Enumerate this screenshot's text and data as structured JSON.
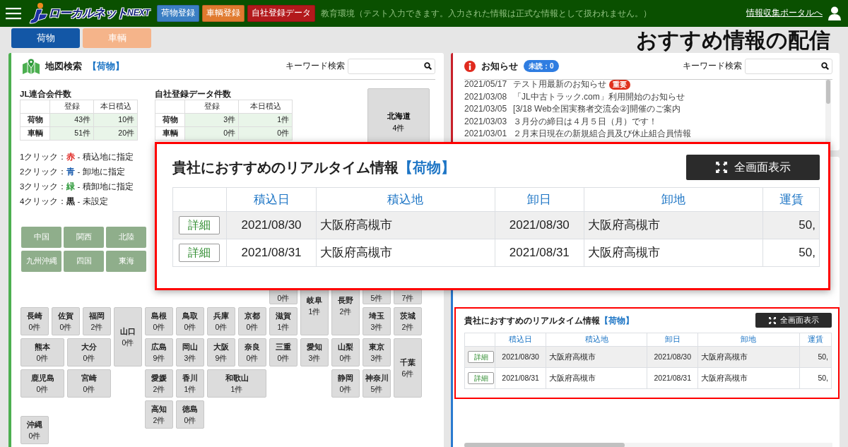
{
  "header": {
    "logo": {
      "name": "ローカルネット",
      "suffix": "NEXT"
    },
    "buttons": [
      {
        "label": "荷物登録",
        "color": "#3b7fc4"
      },
      {
        "label": "車輌登録",
        "color": "#e07a2e"
      },
      {
        "label": "自社登録データ",
        "color": "#b3191c"
      }
    ],
    "environment_notice": "教育環境（テスト入力できます。入力された情報は正式な情報として扱われません。）",
    "portal_link": "情報収集ポータルへ"
  },
  "tabs": [
    {
      "label": "荷物",
      "selected": true
    },
    {
      "label": "車輌",
      "selected": false
    }
  ],
  "page_title": "おすすめ情報の配信",
  "map_search": {
    "title": "地図検索",
    "category": "【荷物】",
    "search_label": "キーワード検索",
    "count_tables": [
      {
        "title": "JL連合会件数",
        "columns": [
          "登録",
          "本日積込"
        ],
        "rows": [
          {
            "label": "荷物",
            "values": [
              "43件",
              "10件"
            ]
          },
          {
            "label": "車輌",
            "values": [
              "51件",
              "20件"
            ]
          }
        ]
      },
      {
        "title": "自社登録データ件数",
        "columns": [
          "登録",
          "本日積込"
        ],
        "rows": [
          {
            "label": "荷物",
            "values": [
              "3件",
              "1件"
            ]
          },
          {
            "label": "車輌",
            "values": [
              "0件",
              "0件"
            ]
          }
        ]
      }
    ],
    "hokkaido": {
      "name": "北海道",
      "count": "4件"
    },
    "legend": [
      {
        "prefix": "1クリック：",
        "word": "赤",
        "color": "#e0201b",
        "suffix": " - 積込地に指定"
      },
      {
        "prefix": "2クリック：",
        "word": "青",
        "color": "#1f5fae",
        "suffix": " - 卸地に指定"
      },
      {
        "prefix": "3クリック：",
        "word": "緑",
        "color": "#2e9a3a",
        "suffix": " - 積卸地に指定"
      },
      {
        "prefix": "4クリック：",
        "word": "黒",
        "color": "#111111",
        "suffix": " - 未設定"
      }
    ],
    "regions": [
      "中国",
      "関西",
      "北陸",
      "九州沖縄",
      "四国",
      "東海"
    ],
    "prefectures": [
      {
        "count": "0件"
      },
      {
        "name": "岐阜",
        "count": "1件"
      },
      {
        "name": "長野",
        "count": "2件"
      },
      {
        "count": "5件"
      },
      {
        "count": "7件"
      },
      {
        "name": "長崎",
        "count": "0件"
      },
      {
        "name": "佐賀",
        "count": "0件"
      },
      {
        "name": "福岡",
        "count": "2件"
      },
      {
        "name": "山口",
        "count": "0件"
      },
      {
        "name": "島根",
        "count": "0件"
      },
      {
        "name": "鳥取",
        "count": "0件"
      },
      {
        "name": "兵庫",
        "count": "0件"
      },
      {
        "name": "京都",
        "count": "0件"
      },
      {
        "name": "滋賀",
        "count": "1件"
      },
      {
        "name": "埼玉",
        "count": "3件"
      },
      {
        "name": "茨城",
        "count": "2件"
      },
      {
        "name": "熊本",
        "count": "0件"
      },
      {
        "name": "大分",
        "count": "0件"
      },
      {
        "name": "広島",
        "count": "9件"
      },
      {
        "name": "岡山",
        "count": "3件"
      },
      {
        "name": "大阪",
        "count": "9件"
      },
      {
        "name": "奈良",
        "count": "0件"
      },
      {
        "name": "三重",
        "count": "0件"
      },
      {
        "name": "愛知",
        "count": "3件"
      },
      {
        "name": "山梨",
        "count": "0件"
      },
      {
        "name": "東京",
        "count": "3件"
      },
      {
        "name": "千葉",
        "count": "6件"
      },
      {
        "name": "鹿児島",
        "count": "0件"
      },
      {
        "name": "宮崎",
        "count": "0件"
      },
      {
        "name": "愛媛",
        "count": "2件"
      },
      {
        "name": "香川",
        "count": "1件"
      },
      {
        "name": "和歌山",
        "count": "1件"
      },
      {
        "name": "静岡",
        "count": "0件"
      },
      {
        "name": "神奈川",
        "count": "5件"
      },
      {
        "name": "高知",
        "count": "2件"
      },
      {
        "name": "徳島",
        "count": "0件"
      },
      {
        "name": "沖縄",
        "count": "0件"
      }
    ]
  },
  "notices": {
    "title": "お知らせ",
    "unread_badge": "未読：0",
    "search_label": "キーワード検索",
    "items": [
      {
        "date": "2021/05/17",
        "text": "テスト用最新のお知らせ",
        "badge": "重要"
      },
      {
        "date": "2021/03/08",
        "text": "「JL中古トラック.com」利用開始のお知らせ"
      },
      {
        "date": "2021/03/05",
        "text": "[3/18 Web全国実務者交流会②]開催のご案内"
      },
      {
        "date": "2021/03/03",
        "text": "３月分の締日は４月５日（月）です！"
      },
      {
        "date": "2021/03/01",
        "text": "２月末日現在の新規組合員及び休止組合員情報"
      }
    ]
  },
  "recommendation": {
    "title": "貴社におすすめのリアルタイム情報",
    "category": "【荷物】",
    "fullscreen_button": "全画面表示",
    "columns": [
      "積込日",
      "積込地",
      "卸日",
      "卸地",
      "運賃"
    ],
    "rows": [
      {
        "detail_button": "詳細",
        "cells": [
          "2021/08/30",
          "大阪府高槻市",
          "2021/08/30",
          "大阪府高槻市",
          "50,"
        ]
      },
      {
        "detail_button": "詳細",
        "cells": [
          "2021/08/31",
          "大阪府高槻市",
          "2021/08/31",
          "大阪府高槻市",
          "50,"
        ]
      }
    ]
  },
  "recommendation_zoom": {
    "title": "貴社におすすめのリアルタイム情報",
    "category": "【荷物】",
    "fullscreen_button": "全画面表示",
    "columns": [
      "積込日",
      "積込地",
      "卸日",
      "卸地",
      "運賃"
    ],
    "rows": [
      {
        "detail_button": "詳細",
        "cells": [
          "2021/08/30",
          "大阪府高槻市",
          "2021/08/30",
          "大阪府高槻市",
          "50,"
        ]
      },
      {
        "detail_button": "詳細",
        "cells": [
          "2021/08/31",
          "大阪府高槻市",
          "2021/08/31",
          "大阪府高槻市",
          "50,"
        ]
      }
    ]
  }
}
